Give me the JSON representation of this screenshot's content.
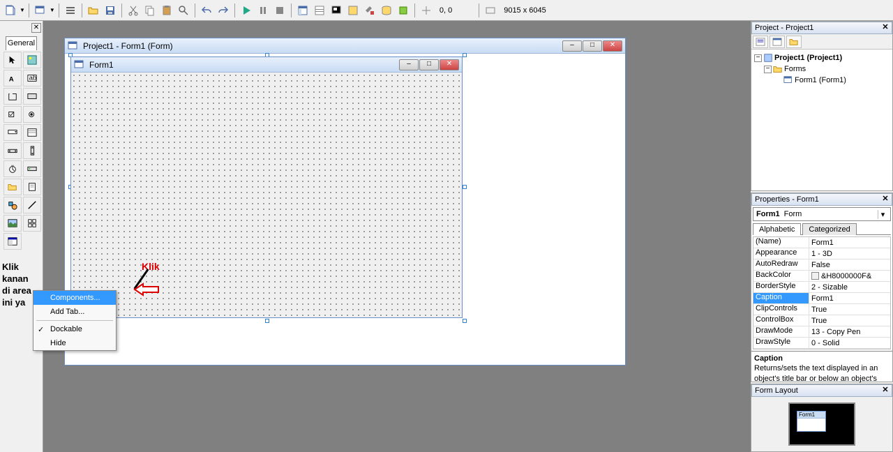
{
  "toolbar": {
    "coords": "0, 0",
    "dimensions": "9015 x 6045"
  },
  "toolbox": {
    "tab_label": "General"
  },
  "annotation": {
    "side_text": "Klik\nkanan\ndi area\nini ya",
    "klik_label": "Klik"
  },
  "context_menu": {
    "components": "Components...",
    "add_tab": "Add Tab...",
    "dockable": "Dockable",
    "hide": "Hide"
  },
  "designer_window": {
    "title": "Project1 - Form1 (Form)"
  },
  "inner_form": {
    "title": "Form1"
  },
  "project_panel": {
    "title": "Project - Project1",
    "root": "Project1 (Project1)",
    "folder": "Forms",
    "form": "Form1 (Form1)"
  },
  "properties_panel": {
    "title": "Properties - Form1",
    "object_name": "Form1",
    "object_type": "Form",
    "tab_alphabetic": "Alphabetic",
    "tab_categorized": "Categorized",
    "rows": [
      {
        "name": "(Name)",
        "value": "Form1"
      },
      {
        "name": "Appearance",
        "value": "1 - 3D"
      },
      {
        "name": "AutoRedraw",
        "value": "False"
      },
      {
        "name": "BackColor",
        "value": "&H8000000F&",
        "swatch": true
      },
      {
        "name": "BorderStyle",
        "value": "2 - Sizable"
      },
      {
        "name": "Caption",
        "value": "Form1",
        "selected": true
      },
      {
        "name": "ClipControls",
        "value": "True"
      },
      {
        "name": "ControlBox",
        "value": "True"
      },
      {
        "name": "DrawMode",
        "value": "13 - Copy Pen"
      },
      {
        "name": "DrawStyle",
        "value": "0 - Solid"
      }
    ],
    "desc_title": "Caption",
    "desc_text": "Returns/sets the text displayed in an object's title bar or below an object's icon."
  },
  "form_layout": {
    "title": "Form Layout",
    "mini_title": "Form1"
  }
}
